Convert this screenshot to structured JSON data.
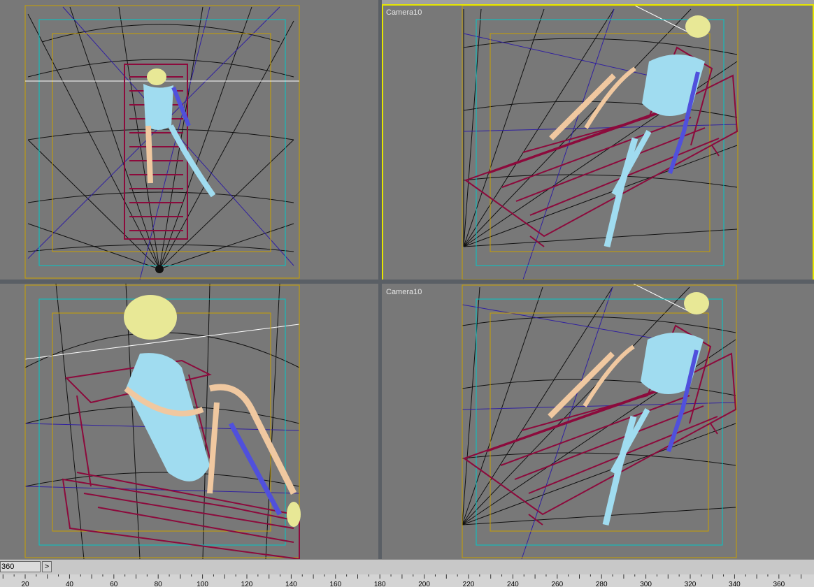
{
  "viewports": {
    "top_left": {
      "label": ""
    },
    "top_right": {
      "label": "Camera10",
      "active": true
    },
    "bottom_left": {
      "label": ""
    },
    "bottom_right": {
      "label": "Camera10"
    }
  },
  "time_slider": {
    "current_frame": "360",
    "next_label": ">"
  },
  "track_bar": {
    "ticks": [
      "20",
      "40",
      "60",
      "80",
      "100",
      "120",
      "140",
      "160",
      "180",
      "200",
      "220",
      "240",
      "260",
      "280",
      "300",
      "320",
      "340",
      "360"
    ]
  },
  "colors": {
    "viewport_bg": "#787878",
    "active_border": "#e6e600",
    "safe_frame_outer": "#c8a000",
    "safe_frame_mid": "#00c8c8",
    "chair": "#8c0a3c",
    "skeleton": "#a0dcf0",
    "skull": "#e8e896",
    "arm": "#f0c8a0",
    "strap": "#5050dc"
  }
}
